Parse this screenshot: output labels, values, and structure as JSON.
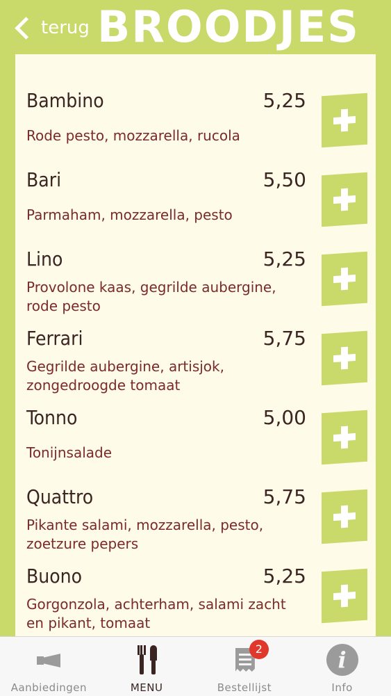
{
  "header": {
    "back_label": "terug",
    "title": "BROODJES"
  },
  "items": [
    {
      "name": "Bambino",
      "price": "5,25",
      "desc": "Rode pesto, mozzarella, rucola"
    },
    {
      "name": "Bari",
      "price": "5,50",
      "desc": "Parmaham, mozzarella, pesto"
    },
    {
      "name": "Lino",
      "price": "5,25",
      "desc": "Provolone kaas, gegrilde aubergine, rode pesto"
    },
    {
      "name": "Ferrari",
      "price": "5,75",
      "desc": "Gegrilde aubergine, artisjok, zongedroogde tomaat"
    },
    {
      "name": "Tonno",
      "price": "5,00",
      "desc": "Tonijnsalade"
    },
    {
      "name": "Quattro",
      "price": "5,75",
      "desc": "Pikante salami, mozzarella, pesto, zoetzure pepers"
    },
    {
      "name": "Buono",
      "price": "5,25",
      "desc": "Gorgonzola, achterham, salami zacht en pikant, tomaat"
    }
  ],
  "tabbar": {
    "tabs": [
      {
        "label": "Aanbiedingen",
        "icon": "megaphone-icon"
      },
      {
        "label": "MENU",
        "icon": "fork-knife-icon"
      },
      {
        "label": "Bestellijst",
        "icon": "receipt-icon",
        "badge": "2"
      },
      {
        "label": "Info",
        "icon": "info-icon"
      }
    ]
  },
  "colors": {
    "accent": "#c9d96a",
    "panel": "#fefbe9",
    "name_text": "#3b2522",
    "desc_text": "#7b2a2a",
    "badge": "#e0382b"
  }
}
